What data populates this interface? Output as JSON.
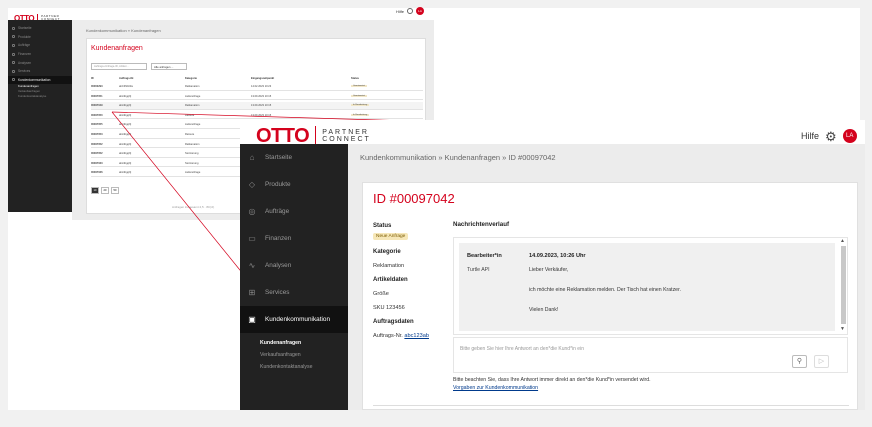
{
  "logo": {
    "brand": "OTTO",
    "sub1": "PARTNER",
    "sub2": "CONNECT"
  },
  "header": {
    "help": "Hilfe",
    "avatar": "LA"
  },
  "sidebar": {
    "items": [
      {
        "label": "Startseite",
        "icon": "house-icon"
      },
      {
        "label": "Produkte",
        "icon": "tag-icon"
      },
      {
        "label": "Aufträge",
        "icon": "cart-icon"
      },
      {
        "label": "Finanzen",
        "icon": "wallet-icon"
      },
      {
        "label": "Analysen",
        "icon": "chart-icon"
      },
      {
        "label": "Services",
        "icon": "puzzle-icon"
      },
      {
        "label": "Kundenkommunikation",
        "icon": "chat-icon"
      }
    ],
    "subitems": [
      "Kundenanfragen",
      "Verkaufsanfragen",
      "Kundenkontaktanalyse"
    ]
  },
  "small": {
    "breadcrumb": "Kundenkommunikation » Kundenanfragen",
    "title": "Kundenanfragen",
    "search_placeholder": "Auftrags-/Anfrage-ID, Artikel...",
    "filter": "Alle anfragen",
    "headers": [
      "ID",
      "Auftrags-Nr.",
      "Kategorie",
      "Eingangszeitpunkt",
      "Status"
    ],
    "rows": [
      {
        "id": "00000293",
        "order": "abC3N1Dks",
        "cat": "Reklamation",
        "dt": "14.02.2023 10:23",
        "st": "Geantwortet"
      },
      {
        "id": "00097051",
        "order": "abc4bgqXj",
        "cat": "Lieferanfrage",
        "dt": "13.09.2023 10:15",
        "st": "Geantwortet"
      },
      {
        "id": "00097049",
        "order": "abc4bgqXj",
        "cat": "Reklamation",
        "dt": "13.09.2023 10:15",
        "st": "In Bearbeitung"
      },
      {
        "id": "00097050",
        "order": "abc4bgqXj",
        "cat": "Retoure",
        "dt": "13.09.2023 10:15",
        "st": "In Bearbeitung"
      },
      {
        "id": "00097055",
        "order": "abc4bgqXj",
        "cat": "Lieferanfrage",
        "dt": "",
        "st": ""
      },
      {
        "id": "00097053",
        "order": "abc4bgqXj",
        "cat": "Retoure",
        "dt": "",
        "st": ""
      },
      {
        "id": "00097052",
        "order": "abc4bgqXj",
        "cat": "Reklamation",
        "dt": "",
        "st": ""
      },
      {
        "id": "00097052",
        "order": "abc4bgqXj",
        "cat": "Stornierung",
        "dt": "",
        "st": ""
      },
      {
        "id": "00097033",
        "order": "abc4bgqXj",
        "cat": "Stornierung",
        "dt": "",
        "st": ""
      },
      {
        "id": "00097036",
        "order": "abc4bgqXj",
        "cat": "Lieferanfrage",
        "dt": "",
        "st": ""
      }
    ],
    "pages": [
      "10",
      "20",
      "50"
    ],
    "footer": "Anfragen insgesamt",
    "footer_count": "2,5 · 80(.0)"
  },
  "detail": {
    "breadcrumb": "Kundenkommunikation » Kundenanfragen » ID #00097042",
    "id_title": "ID #00097042",
    "status_label": "Status",
    "status_badge": "Neue Anfrage",
    "category_label": "Kategorie",
    "category_value": "Reklamation",
    "article_label": "Artikeldaten",
    "size_value": "Größe",
    "sku_value": "SKU 123456",
    "order_label": "Auftragsdaten",
    "order_prefix": "Auftrags-Nr.",
    "order_link": "abc123ab",
    "history_title": "Nachrichtenverlauf",
    "msg_author": "Bearbeiter*in",
    "msg_date": "14.09.2023, 10:26 Uhr",
    "msg_from": "Turtle API",
    "msg_greeting": "Lieber Verkäufer,",
    "msg_body": "ich möchte eine Reklamation melden. Der Tisch hat einen Kratzer.",
    "msg_close": "Vielen Dank!",
    "reply_placeholder": "Bitte geben Sie hier Ihre Antwort an den*die Kund*in ein",
    "note": "Bitte beachten Sie, dass Ihre Antwort immer direkt an den*die Kund*in versendet wird.",
    "guidelines_link": "Vorgaben zur Kundenkommunikation"
  },
  "colors": {
    "brand": "#d4021d",
    "sidebar": "#222222",
    "badge": "#f6e7b8"
  }
}
